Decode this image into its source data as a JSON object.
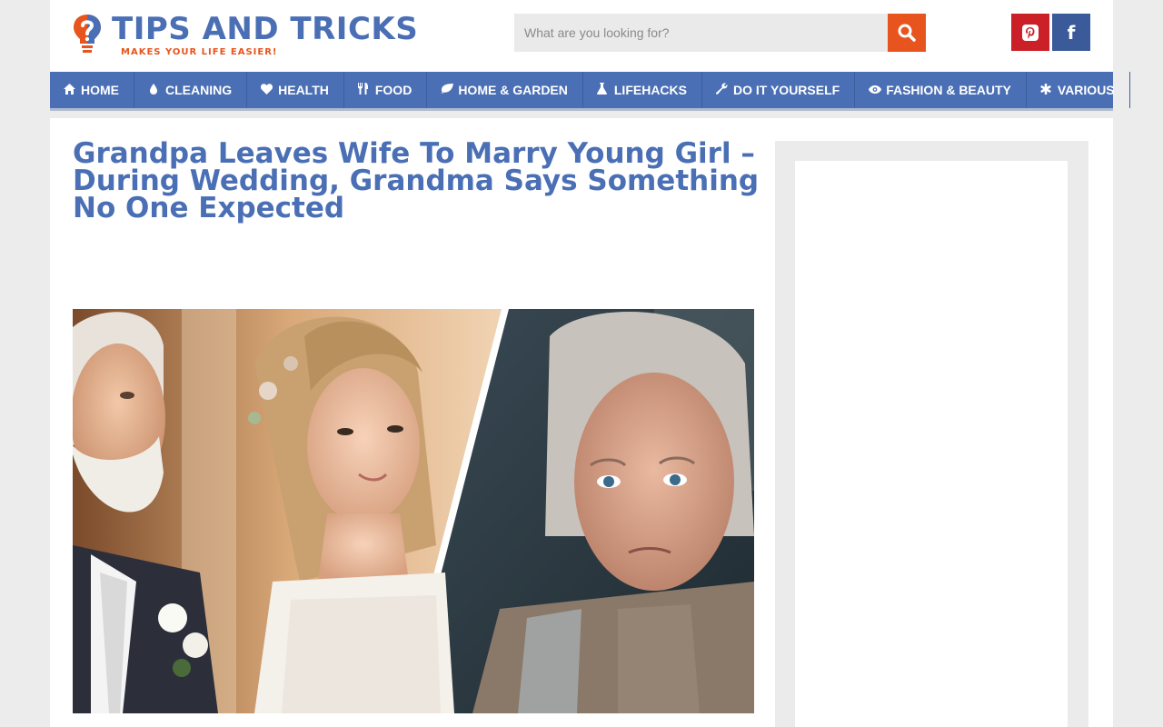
{
  "header": {
    "logo_title": "TIPS AND TRICKS",
    "logo_tagline": "MAKES YOUR LIFE EASIER!",
    "search_placeholder": "What are you looking for?"
  },
  "nav": {
    "items": [
      {
        "label": "HOME",
        "icon": "home-icon"
      },
      {
        "label": "CLEANING",
        "icon": "droplet-icon"
      },
      {
        "label": "HEALTH",
        "icon": "heart-icon"
      },
      {
        "label": "FOOD",
        "icon": "cutlery-icon"
      },
      {
        "label": "HOME & GARDEN",
        "icon": "leaf-icon"
      },
      {
        "label": "LIFEHACKS",
        "icon": "flask-icon"
      },
      {
        "label": "DO IT YOURSELF",
        "icon": "wrench-icon"
      },
      {
        "label": "FASHION & BEAUTY",
        "icon": "eye-icon"
      },
      {
        "label": "VARIOUS",
        "icon": "asterisk-icon"
      }
    ]
  },
  "article": {
    "title": "Grandpa Leaves Wife To Marry Young Girl – During Wedding, Grandma Says Something No One Expected"
  },
  "colors": {
    "brand_blue": "#4a6fb5",
    "accent_orange": "#e8541e",
    "pinterest_red": "#cb2027",
    "facebook_blue": "#3b5a9a"
  }
}
